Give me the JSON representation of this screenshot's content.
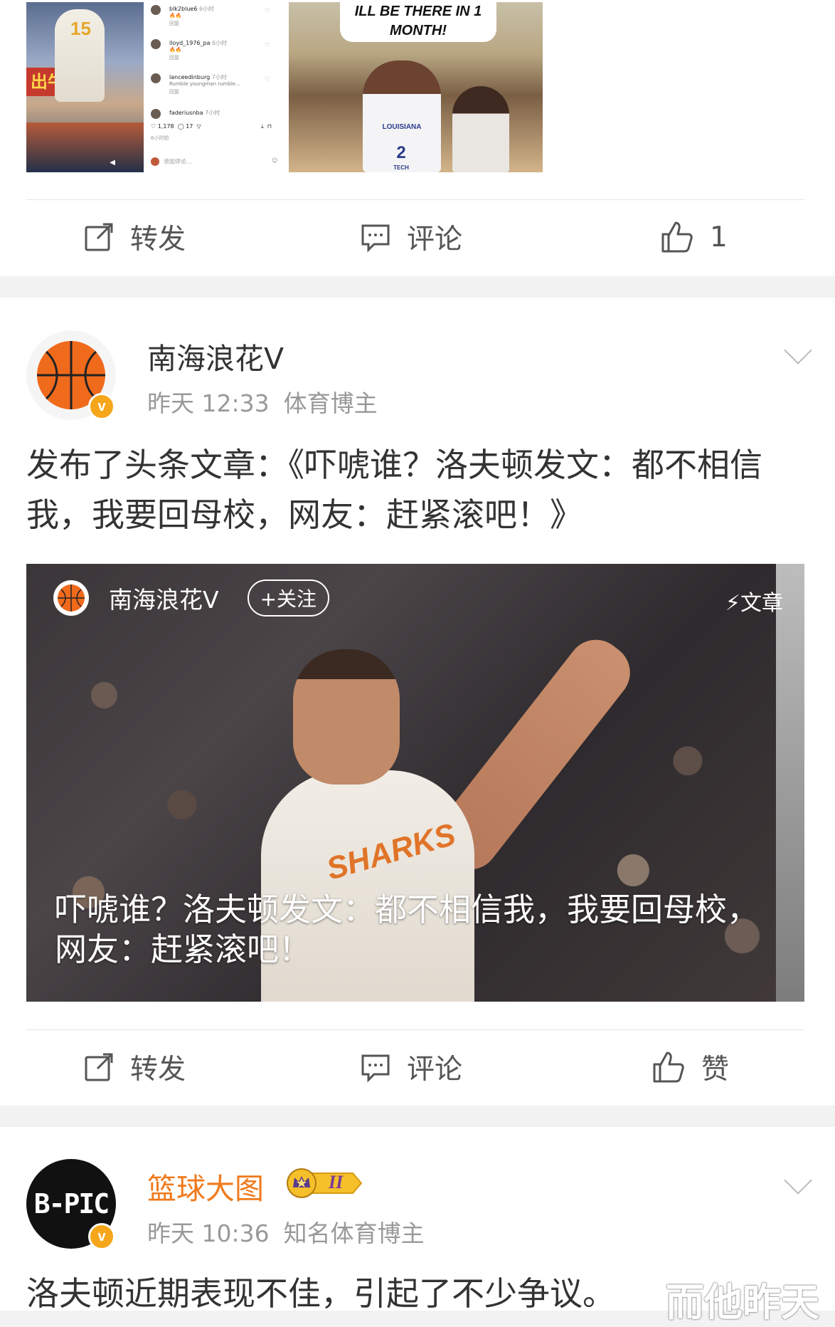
{
  "post1": {
    "images": {
      "shot_a": {
        "jersey_number": "15",
        "sign_text": "出牛"
      },
      "shot_b": {
        "comments": [
          {
            "name": "blk2blue6",
            "time": "6小时",
            "reply": "回复"
          },
          {
            "name": "lloyd_1976_pa",
            "time": "6小时",
            "reply": "回复"
          },
          {
            "name": "lanceedinburg",
            "time": "7小时",
            "text": "Rumble youngman rumble...",
            "reply": "回复"
          },
          {
            "name": "faderiusnba",
            "time": "7小时"
          }
        ],
        "likes": "1,178",
        "comments_count": "17",
        "time": "6小时前",
        "add_comment": "添加评论..."
      },
      "shot_c": {
        "caption_line1": "ILL BE THERE IN 1",
        "caption_line2": "MONTH!",
        "jersey_school": "LOUISIANA",
        "jersey_number": "2",
        "jersey_sub": "TECH"
      }
    },
    "actions": {
      "repost": "转发",
      "comment": "评论",
      "like": "1"
    }
  },
  "post2": {
    "author": "南海浪花V",
    "time": "昨天 12:33",
    "tag": "体育博主",
    "text": "发布了头条文章：《吓唬谁？洛夫顿发文：都不相信我，我要回母校，网友：赶紧滚吧！》",
    "article": {
      "author": "南海浪花V",
      "follow": "+关注",
      "type": "⚡文章",
      "jersey": "SHARKS",
      "title": "吓唬谁？洛夫顿发文：都不相信我，我要回母校，网友：赶紧滚吧！"
    },
    "actions": {
      "repost": "转发",
      "comment": "评论",
      "like": "赞"
    }
  },
  "post3": {
    "avatar_text": "B-PIC",
    "author": "篮球大图",
    "level": "II",
    "time": "昨天 10:36",
    "tag": "知名体育博主",
    "text": "洛夫顿近期表现不佳，引起了不少争议。",
    "watermark": "而他昨天"
  },
  "colors": {
    "accent_orange": "#f07a1c",
    "verified": "#f6a61b",
    "text_gray": "#999999"
  }
}
